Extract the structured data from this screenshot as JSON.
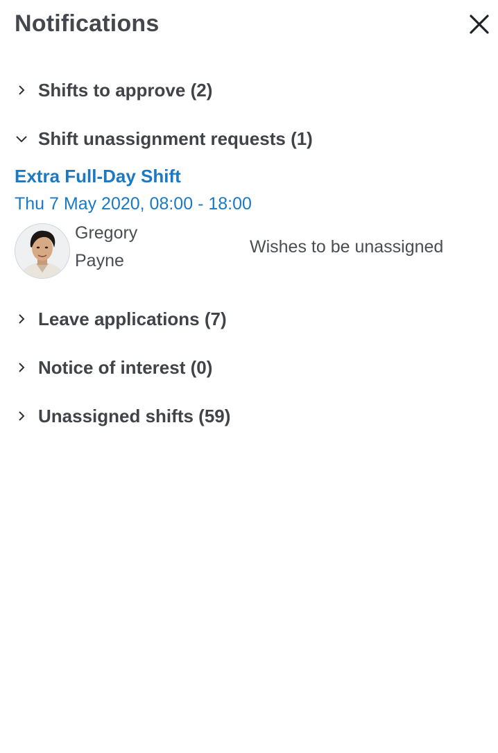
{
  "header": {
    "title": "Notifications",
    "close_icon": "close-icon"
  },
  "sections": [
    {
      "label": "Shifts to approve (2)",
      "expanded": false
    },
    {
      "label": "Shift unassignment requests (1)",
      "expanded": true
    },
    {
      "label": "Leave applications (7)",
      "expanded": false
    },
    {
      "label": "Notice of interest (0)",
      "expanded": false
    },
    {
      "label": "Unassigned shifts (59)",
      "expanded": false
    }
  ],
  "request": {
    "shift_name": "Extra Full-Day Shift",
    "shift_time": "Thu 7 May 2020, 08:00 - 18:00",
    "person_first": "Gregory",
    "person_last": "Payne",
    "status": "Wishes to be unassigned"
  },
  "colors": {
    "link": "#1a79c2",
    "text": "#404348"
  }
}
